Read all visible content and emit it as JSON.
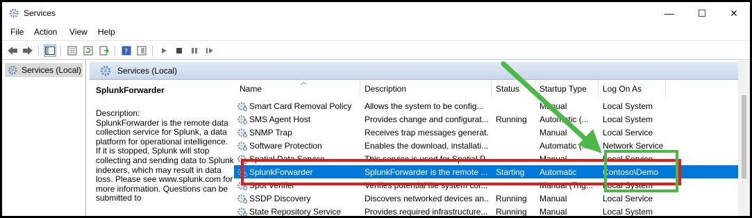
{
  "window": {
    "title": "Services",
    "minimize": "—",
    "maximize": "☐",
    "close": "✕"
  },
  "menu": [
    "File",
    "Action",
    "View",
    "Help"
  ],
  "tree": {
    "item": "Services (Local)"
  },
  "pane": {
    "header": "Services (Local)",
    "selected_name": "SplunkForwarder",
    "desc_label": "Description:",
    "desc_text": "SplunkForwarder is the remote data collection service for Splunk, a data platform for operational intelligence. If it is stopped, Splunk will stop collecting and sending data to Splunk indexers, which may result in data loss. Please see www.splunk.com for more information. Questions can be submitted to"
  },
  "columns": {
    "name": "Name",
    "description": "Description",
    "status": "Status",
    "startup": "Startup Type",
    "logon": "Log On As"
  },
  "rows": [
    {
      "name": "Smart Card Removal Policy",
      "description": "Allows the system to be config...",
      "status": "",
      "startup": "Manual",
      "logon": "Local System"
    },
    {
      "name": "SMS Agent Host",
      "description": "Provides change and configurat...",
      "status": "Running",
      "startup": "Automatic (...",
      "logon": "Local System"
    },
    {
      "name": "SNMP Trap",
      "description": "Receives trap messages generat...",
      "status": "",
      "startup": "Manual",
      "logon": "Local Service"
    },
    {
      "name": "Software Protection",
      "description": "Enables the download, installati...",
      "status": "",
      "startup": "Automatic (...",
      "logon": "Network Service"
    },
    {
      "name": "Spatial Data Service",
      "description": "This service is used for Spatial P...",
      "status": "",
      "startup": "Manual",
      "logon": "Local Service"
    },
    {
      "name": "SplunkForwarder",
      "description": "SplunkForwarder is the remote ...",
      "status": "Starting",
      "startup": "Automatic",
      "logon": "Contoso\\Demo"
    },
    {
      "name": "Spot Verifier",
      "description": "Verifies potential file system cor...",
      "status": "",
      "startup": "Manual (Trig...",
      "logon": "Local System"
    },
    {
      "name": "SSDP Discovery",
      "description": "Discovers networked devices an...",
      "status": "Running",
      "startup": "Manual",
      "logon": "Local Service"
    },
    {
      "name": "State Repository Service",
      "description": "Provides required infrastructure...",
      "status": "Running",
      "startup": "Manual",
      "logon": "Local System"
    }
  ],
  "selected_row_index": 5,
  "colors": {
    "selection": "#0078d7",
    "highlight_red": "#e21b1b",
    "highlight_green": "#4cb848"
  }
}
